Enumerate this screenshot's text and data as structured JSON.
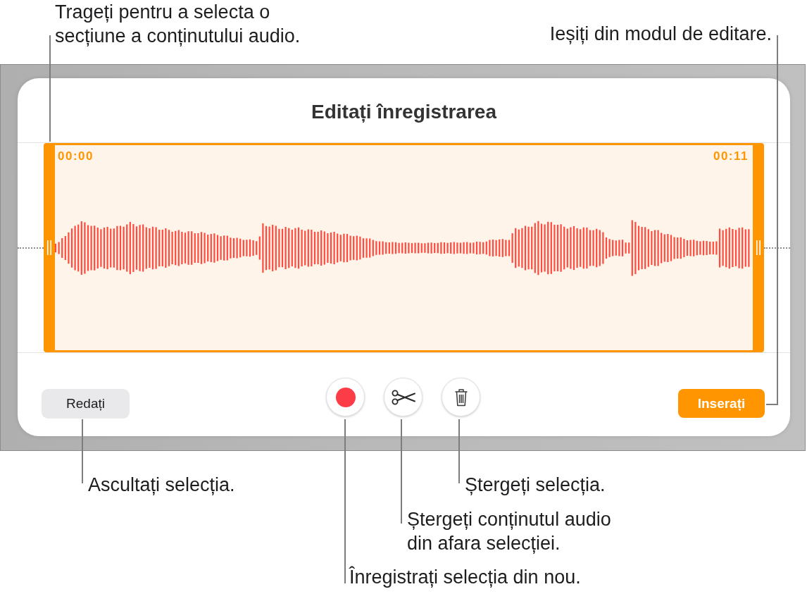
{
  "top_callouts": [
    "Trageți pentru a selecta o secțiune a conținutului audio.",
    "Ieșiți din modul de editare."
  ],
  "dialog": {
    "title": "Editați înregistrarea",
    "selection": {
      "start_time": "00:00",
      "end_time": "00:11"
    },
    "play_button": {
      "label": "Redați"
    },
    "insert_button": {
      "label": "Inserați"
    }
  },
  "bottom_callouts": [
    "Ascultați selecția.",
    "Ștergeți selecția.",
    "Ștergeți conținutul audio din afara selecției.",
    "Înregistrați selecția din nou."
  ]
}
